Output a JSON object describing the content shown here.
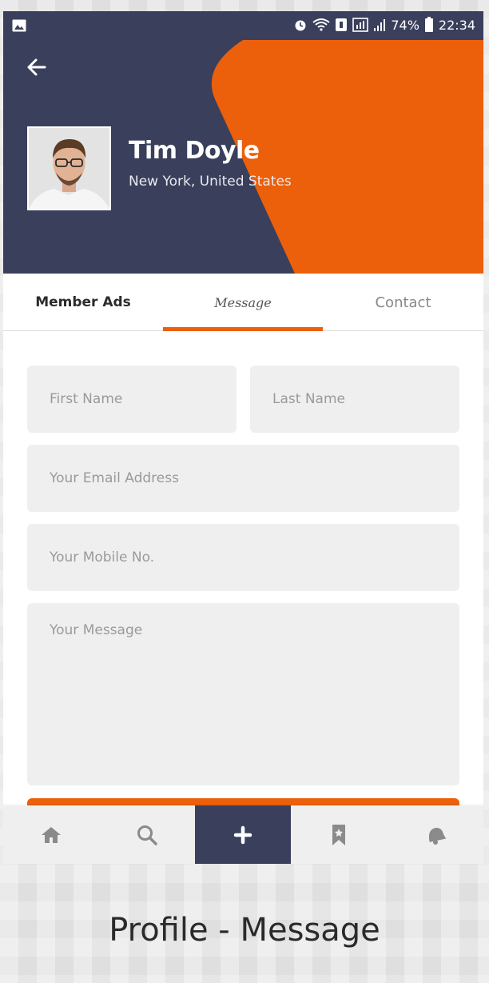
{
  "status_bar": {
    "battery": "74%",
    "time": "22:34"
  },
  "profile": {
    "name": "Tim Doyle",
    "location": "New York, United States"
  },
  "tabs": [
    {
      "label": "Member Ads"
    },
    {
      "label": "Message",
      "active": true
    },
    {
      "label": "Contact"
    }
  ],
  "form": {
    "first_name": {
      "placeholder": "First Name",
      "value": ""
    },
    "last_name": {
      "placeholder": "Last Name",
      "value": ""
    },
    "email": {
      "placeholder": "Your Email Address",
      "value": ""
    },
    "mobile": {
      "placeholder": "Your Mobile No.",
      "value": ""
    },
    "message": {
      "placeholder": "Your Message",
      "value": ""
    }
  },
  "bottom_nav": [
    {
      "icon": "home-icon"
    },
    {
      "icon": "search-icon"
    },
    {
      "icon": "plus-icon",
      "active": true
    },
    {
      "icon": "bookmark-icon"
    },
    {
      "icon": "notification-bell-icon"
    }
  ],
  "caption": "Profile - Message",
  "colors": {
    "header_navy": "#3a3f5c",
    "accent_orange": "#ec5f0b",
    "field_bg": "#efefef"
  }
}
